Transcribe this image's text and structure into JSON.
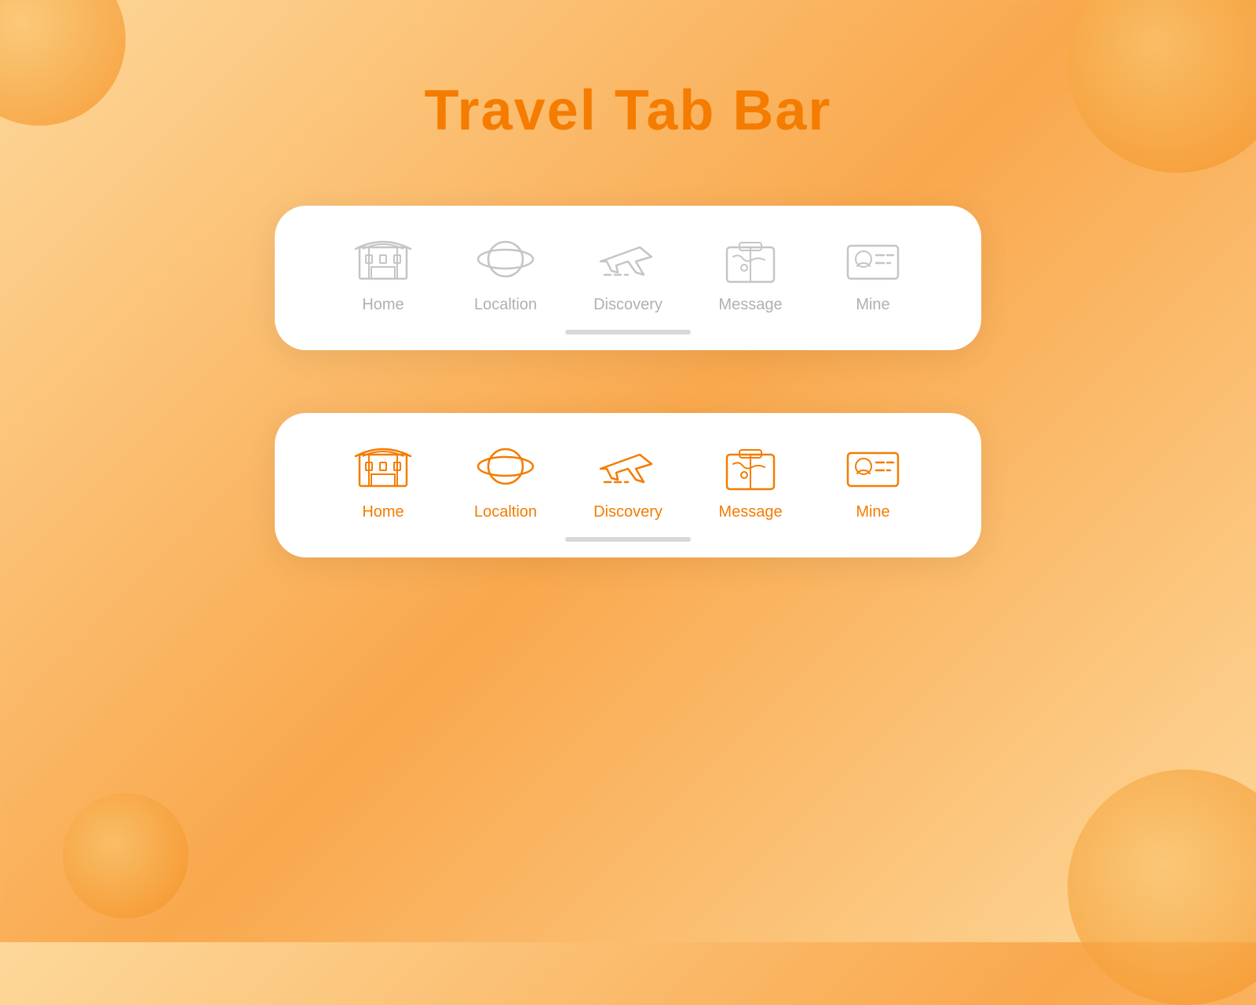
{
  "page": {
    "title": "Travel Tab Bar",
    "title_color": "#f47c00"
  },
  "tab_bars": [
    {
      "id": "inactive-bar",
      "variant": "inactive",
      "tabs": [
        {
          "id": "home",
          "label": "Home"
        },
        {
          "id": "location",
          "label": "Localtion"
        },
        {
          "id": "discovery",
          "label": "Discovery",
          "active": false
        },
        {
          "id": "message",
          "label": "Message"
        },
        {
          "id": "mine",
          "label": "Mine"
        }
      ]
    },
    {
      "id": "active-bar",
      "variant": "active",
      "tabs": [
        {
          "id": "home",
          "label": "Home"
        },
        {
          "id": "location",
          "label": "Localtion"
        },
        {
          "id": "discovery",
          "label": "Discovery",
          "active": true
        },
        {
          "id": "message",
          "label": "Message"
        },
        {
          "id": "mine",
          "label": "Mine"
        }
      ]
    }
  ],
  "indicator": {
    "color": "#d8d8d8"
  }
}
